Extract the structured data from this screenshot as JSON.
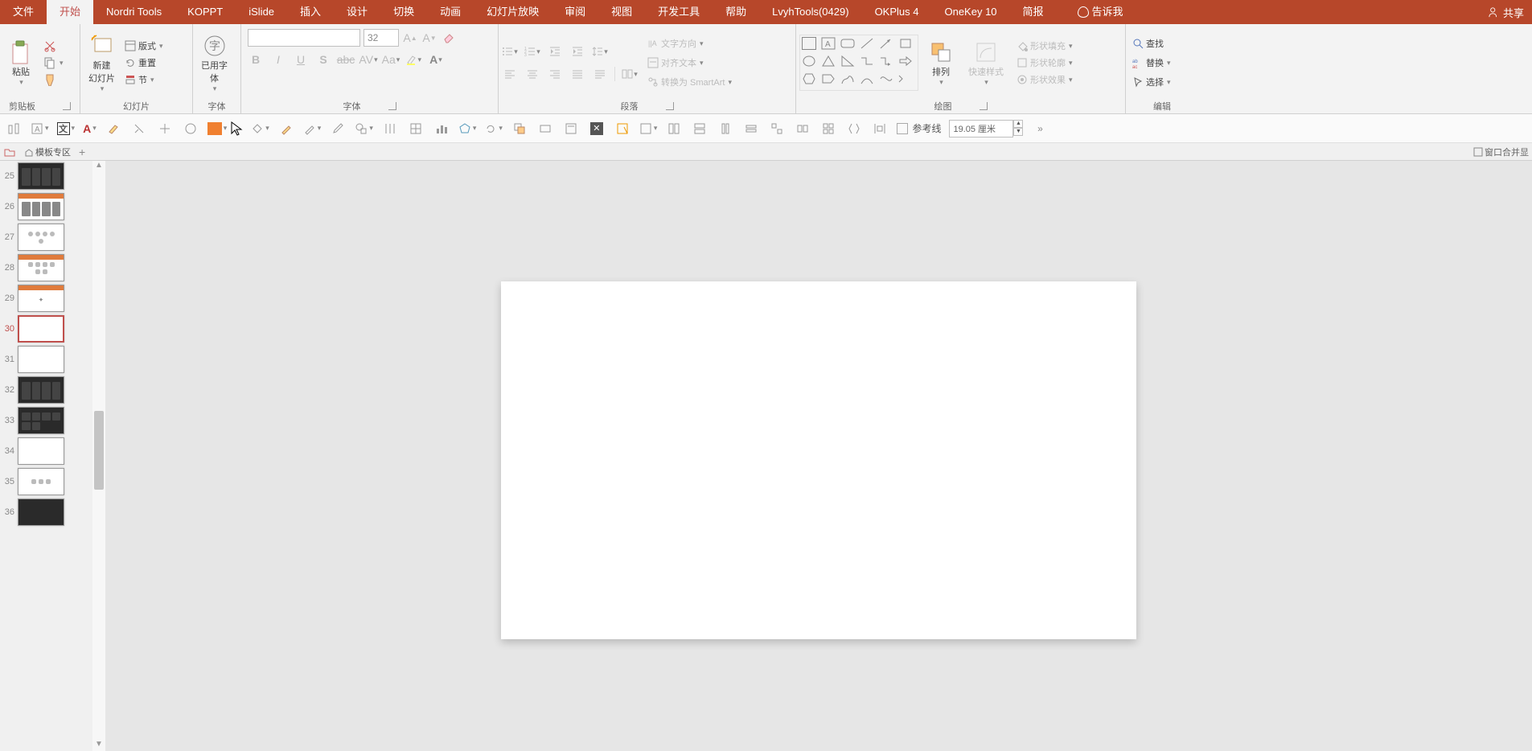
{
  "titlebar": {
    "tabs": [
      "文件",
      "开始",
      "Nordri Tools",
      "KOPPT",
      "iSlide",
      "插入",
      "设计",
      "切换",
      "动画",
      "幻灯片放映",
      "审阅",
      "视图",
      "开发工具",
      "帮助",
      "LvyhTools(0429)",
      "OKPlus 4",
      "OneKey 10",
      "简报"
    ],
    "active_index": 1,
    "tellme": "告诉我",
    "share": "共享"
  },
  "ribbon": {
    "clipboard": {
      "paste": "粘贴",
      "label": "剪贴板"
    },
    "slides": {
      "new_slide": "新建\n幻灯片",
      "format": "版式",
      "reset": "重置",
      "section": "节",
      "label": "幻灯片"
    },
    "usedfont": {
      "btn": "已用字\n体",
      "label": "字体"
    },
    "font": {
      "size": "32",
      "label": "字体"
    },
    "paragraph": {
      "text_dir": "文字方向",
      "align_text": "对齐文本",
      "smartart": "转换为 SmartArt",
      "label": "段落"
    },
    "drawing": {
      "arrange": "排列",
      "quick_style": "快速样式",
      "shape_fill": "形状填充",
      "shape_outline": "形状轮廓",
      "shape_effect": "形状效果",
      "label": "绘图"
    },
    "editing": {
      "find": "查找",
      "replace": "替换",
      "select": "选择",
      "label": "编辑"
    }
  },
  "tb2": {
    "guides": "参考线",
    "size_value": "19.05 厘米"
  },
  "tabstrip": {
    "template": "模板专区",
    "win_merge": "窗口合并显"
  },
  "thumbs": {
    "start": 25,
    "labels": [
      "25",
      "26",
      "27",
      "28",
      "29",
      "30",
      "31",
      "32",
      "33",
      "34",
      "35",
      "36"
    ],
    "selected": 30
  }
}
